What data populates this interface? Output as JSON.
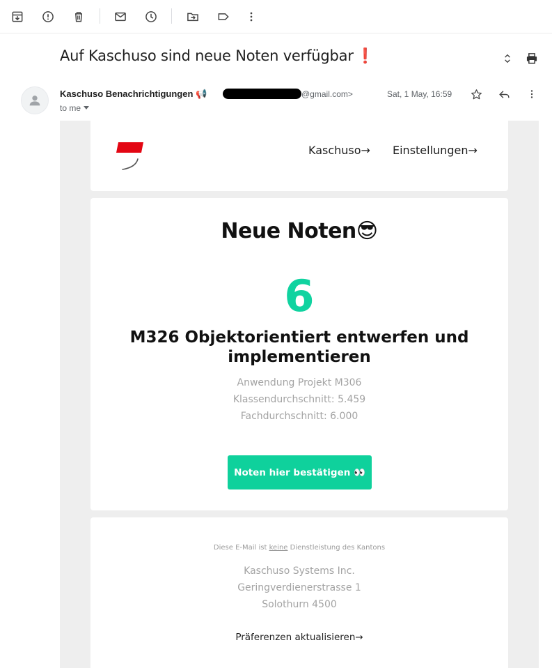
{
  "toolbar": {
    "icons": [
      "archive-icon",
      "report-spam-icon",
      "delete-icon",
      "mark-unread-icon",
      "snooze-icon",
      "move-to-icon",
      "label-icon",
      "more-vertical-icon"
    ]
  },
  "header": {
    "subject": "Auf Kaschuso sind neue Noten verfügbar",
    "subject_emoji": "❗",
    "sender_name": "Kaschuso Benachrichtigungen 📢",
    "sender_email_suffix": "@gmail.com>",
    "recipient": "to me",
    "date": "Sat, 1 May, 16:59"
  },
  "email": {
    "nav": {
      "kaschuso_link": "Kaschuso→",
      "settings_link": "Einstellungen→"
    },
    "headline": "Neue Noten😎",
    "grade": "6",
    "module": "M326 Objektorientiert entwerfen und implementieren",
    "exam": "Anwendung Projekt M306",
    "class_average": "Klassendurchschnitt: 5.459",
    "subject_average": "Fachdurchschnitt: 6.000",
    "confirm_button": "Noten hier bestätigen 👀",
    "footer": {
      "disclaimer_prefix": "Diese E-Mail ist ",
      "disclaimer_keyword": "keine",
      "disclaimer_suffix": " Dienstleistung des Kantons",
      "company": "Kaschuso Systems Inc.",
      "street": "Geringverdienerstrasse 1",
      "city": "Solothurn 4500",
      "preferences_link": "Präferenzen aktualisieren→"
    }
  },
  "colors": {
    "accent": "#10d3a0",
    "brand_red": "#e30613"
  }
}
